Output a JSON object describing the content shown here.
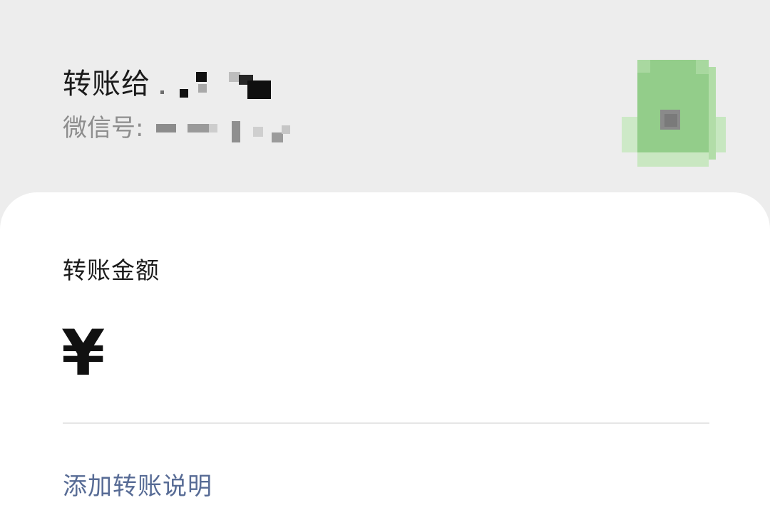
{
  "header": {
    "title": "转账给",
    "wechat_id_label": "微信号:"
  },
  "amount_section": {
    "label": "转账金额",
    "currency_symbol": "¥",
    "input_value": ""
  },
  "note_link": {
    "label": "添加转账说明"
  },
  "colors": {
    "header_bg": "#ededed",
    "card_bg": "#ffffff",
    "link": "#576b95",
    "avatar": "#8fce87"
  }
}
